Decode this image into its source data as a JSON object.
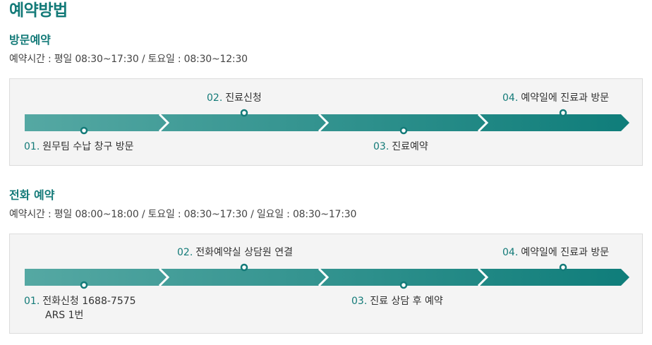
{
  "page_title": "예약방법",
  "sections": [
    {
      "title": "방문예약",
      "hours": "예약시간 : 평일 08:30~17:30 / 토요일 : 08:30~12:30",
      "steps": [
        {
          "num": "01.",
          "label": "원무팀 수납 창구 방문",
          "sub": ""
        },
        {
          "num": "02.",
          "label": "진료신청",
          "sub": ""
        },
        {
          "num": "03.",
          "label": "진료예약",
          "sub": ""
        },
        {
          "num": "04.",
          "label": "예약일에 진료과 방문",
          "sub": ""
        }
      ]
    },
    {
      "title": "전화 예약",
      "hours": "예약시간 : 평일 08:00~18:00 / 토요일 : 08:30~17:30 / 일요일 : 08:30~17:30",
      "steps": [
        {
          "num": "01.",
          "label": "전화신청 1688-7575",
          "sub": "ARS 1번"
        },
        {
          "num": "02.",
          "label": "전화예약실 상담원 연결",
          "sub": ""
        },
        {
          "num": "03.",
          "label": "진료 상담 후 예약",
          "sub": ""
        },
        {
          "num": "04.",
          "label": "예약일에 진료과 방문",
          "sub": ""
        }
      ]
    }
  ],
  "colors": {
    "accent": "#137a78",
    "arrow_light": "#4ea39e",
    "arrow_dark": "#0f7d7a"
  }
}
